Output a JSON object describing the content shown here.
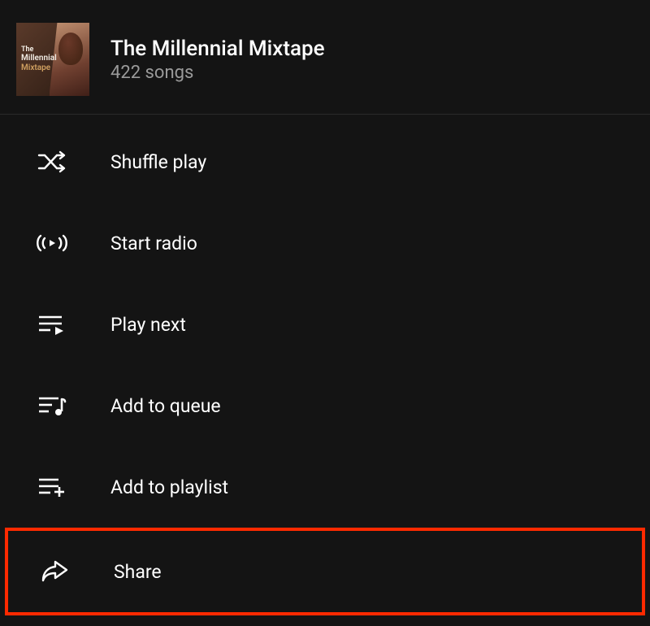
{
  "header": {
    "title": "The Millennial Mixtape",
    "subtitle": "422 songs",
    "album_art_text": {
      "line1": "The",
      "line2": "Millennial",
      "line3": "Mixtape"
    }
  },
  "menu": {
    "shuffle": "Shuffle play",
    "radio": "Start radio",
    "play_next": "Play next",
    "add_queue": "Add to queue",
    "add_playlist": "Add to playlist",
    "share": "Share"
  }
}
